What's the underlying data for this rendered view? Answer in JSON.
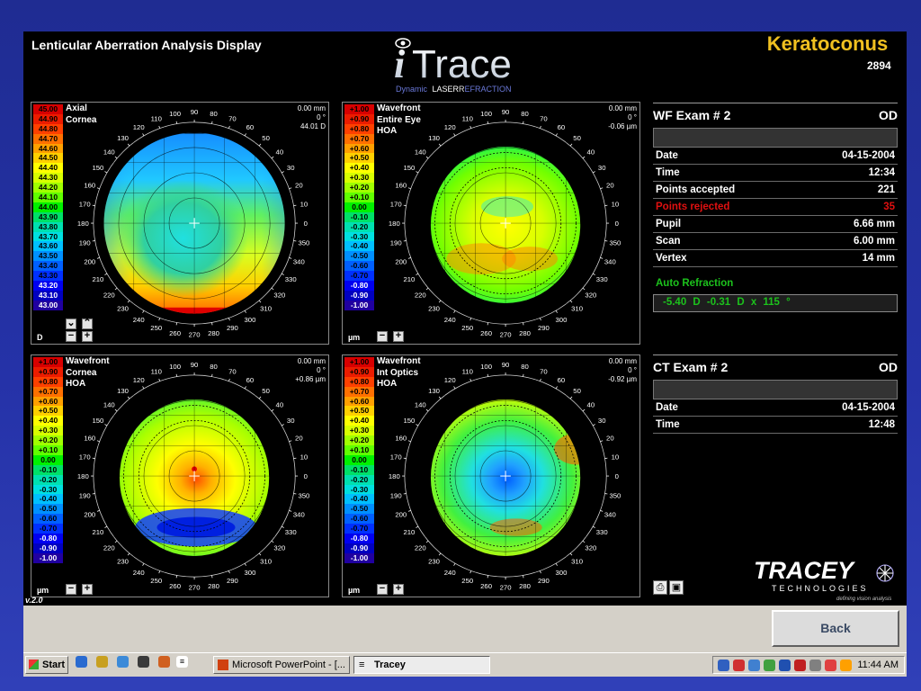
{
  "app": {
    "title": "Lenticular Aberration Analysis Display",
    "keratoconus": "Keratoconus",
    "patient_id": "2894",
    "version": "v.2.0"
  },
  "logo": {
    "main": "Trace",
    "dynamic": "Dynamic",
    "laser": "LASER",
    "refraction": "EFRACTION"
  },
  "maps": [
    {
      "label1": "Axial",
      "label2": "Cornea",
      "label3": "",
      "tr1": "0.00 mm",
      "tr2": "0 °",
      "tr3": "44.01 D",
      "unit": "D",
      "scale": [
        "45.00",
        "44.90",
        "44.80",
        "44.70",
        "44.60",
        "44.50",
        "44.40",
        "44.30",
        "44.20",
        "44.10",
        "44.00",
        "43.90",
        "43.80",
        "43.70",
        "43.60",
        "43.50",
        "43.40",
        "43.30",
        "43.20",
        "43.10",
        "43.00"
      ]
    },
    {
      "label1": "Wavefront",
      "label2": "Entire Eye",
      "label3": "HOA",
      "tr1": "0.00 mm",
      "tr2": "0 °",
      "tr3": "-0.06 µm",
      "unit": "µm",
      "scale": [
        "+1.00",
        "+0.90",
        "+0.80",
        "+0.70",
        "+0.60",
        "+0.50",
        "+0.40",
        "+0.30",
        "+0.20",
        "+0.10",
        "0.00",
        "-0.10",
        "-0.20",
        "-0.30",
        "-0.40",
        "-0.50",
        "-0.60",
        "-0.70",
        "-0.80",
        "-0.90",
        "-1.00"
      ]
    },
    {
      "label1": "Wavefront",
      "label2": "Cornea",
      "label3": "HOA",
      "tr1": "0.00 mm",
      "tr2": "0 °",
      "tr3": "+0.86 µm",
      "unit": "µm",
      "scale": [
        "+1.00",
        "+0.90",
        "+0.80",
        "+0.70",
        "+0.60",
        "+0.50",
        "+0.40",
        "+0.30",
        "+0.20",
        "+0.10",
        "0.00",
        "-0.10",
        "-0.20",
        "-0.30",
        "-0.40",
        "-0.50",
        "-0.60",
        "-0.70",
        "-0.80",
        "-0.90",
        "-1.00"
      ]
    },
    {
      "label1": "Wavefront",
      "label2": "Int Optics",
      "label3": "HOA",
      "tr1": "0.00 mm",
      "tr2": "0 °",
      "tr3": "-0.92 µm",
      "unit": "µm",
      "scale": [
        "+1.00",
        "+0.90",
        "+0.80",
        "+0.70",
        "+0.60",
        "+0.50",
        "+0.40",
        "+0.30",
        "+0.20",
        "+0.10",
        "0.00",
        "-0.10",
        "-0.20",
        "-0.30",
        "-0.40",
        "-0.50",
        "-0.60",
        "-0.70",
        "-0.80",
        "-0.90",
        "-1.00"
      ]
    }
  ],
  "scale_colors": [
    "#d80000",
    "#ec1c00",
    "#ff4000",
    "#ff7000",
    "#ffa000",
    "#ffd000",
    "#ffff00",
    "#d8ff00",
    "#a0ff00",
    "#60ff00",
    "#00f000",
    "#00e068",
    "#00e0b0",
    "#00e0e0",
    "#00c0ff",
    "#0090ff",
    "#0060ff",
    "#0030ff",
    "#0000f0",
    "#0000c0",
    "#2000a0"
  ],
  "angles": [
    "0",
    "10",
    "20",
    "30",
    "40",
    "50",
    "60",
    "70",
    "80",
    "90",
    "100",
    "110",
    "120",
    "130",
    "140",
    "150",
    "160",
    "170",
    "180",
    "190",
    "200",
    "210",
    "220",
    "230",
    "240",
    "250",
    "260",
    "270",
    "280",
    "290",
    "300",
    "310",
    "320",
    "330",
    "340",
    "350"
  ],
  "wf_exam": {
    "title": "WF Exam  # 2",
    "eye": "OD",
    "rows": [
      {
        "label": "Date",
        "value": "04-15-2004"
      },
      {
        "label": "Time",
        "value": "12:34"
      },
      {
        "label": "Points accepted",
        "value": "221"
      },
      {
        "label": "Points rejected",
        "value": "35"
      },
      {
        "label": "Pupil",
        "value": "6.66 mm"
      },
      {
        "label": "Scan",
        "value": "6.00 mm"
      },
      {
        "label": "Vertex",
        "value": "14 mm"
      }
    ],
    "auto_refraction_label": "Auto Refraction",
    "auto_refraction": "-5.40 D    -0.31 D   x   115 °"
  },
  "ct_exam": {
    "title": "CT Exam  # 2",
    "eye": "OD",
    "rows": [
      {
        "label": "Date",
        "value": "04-15-2004"
      },
      {
        "label": "Time",
        "value": "12:48"
      }
    ]
  },
  "brand": {
    "name": "TRACEY",
    "sub": "TECHNOLOGIES",
    "tagline": "defining vision analysis"
  },
  "back_label": "Back",
  "taskbar": {
    "start": "Start",
    "task1": "Microsoft PowerPoint - [...",
    "task2": "Tracey",
    "clock": "11:44 AM"
  },
  "colors": {
    "accent_text": "#f0c020",
    "good": "#1cc21c",
    "bad": "#e01010"
  }
}
